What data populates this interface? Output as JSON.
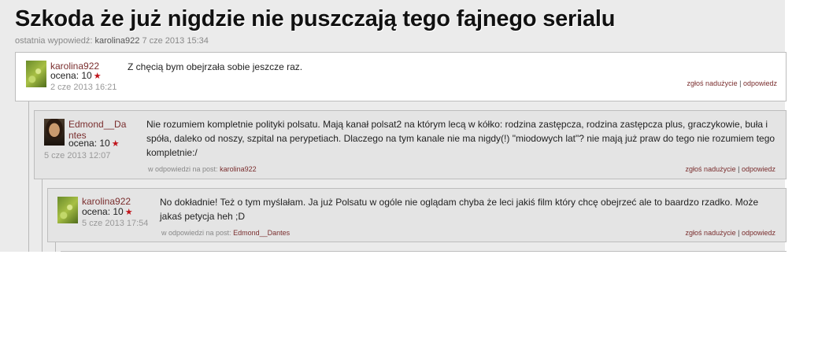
{
  "thread": {
    "title": "Szkoda że już nigdzie nie puszczają tego fajnego serialu",
    "meta_prefix": "ostatnia wypowiedź:",
    "meta_user": "karolina922",
    "meta_date": "7 cze 2013 15:34"
  },
  "posts": [
    {
      "author": "karolina922",
      "rating_label": "ocena: 10",
      "date": "2 cze 2013 16:21",
      "text": "Z chęcią bym obejrzała sobie jeszcze raz.",
      "report": "zgłoś nadużycie",
      "separator": "|",
      "reply": "odpowiedz"
    },
    {
      "author_line1": "Edmond__Da",
      "author_line2": "ntes",
      "rating_label": "ocena: 10",
      "date": "5 cze 2013 12:07",
      "text": "Nie rozumiem kompletnie polityki polsatu. Mają kanał polsat2 na którym lecą w kółko: rodzina zastępcza, rodzina zastępcza plus, graczykowie, buła i spóła, daleko od noszy, szpital na perypetiach. Dlaczego na tym kanale nie ma nigdy(!) \"miodowych lat\"? nie mają już praw do tego nie rozumiem tego kompletnie:/",
      "reply_prefix": "w odpowiedzi na post:",
      "reply_to": "karolina922",
      "report": "zgłoś nadużycie",
      "separator": "|",
      "reply": "odpowiedz"
    },
    {
      "author": "karolina922",
      "rating_label": "ocena: 10",
      "date": "5 cze 2013 17:54",
      "text": "No dokładnie! Też o tym myślałam. Ja już Polsatu w ogóle nie oglądam chyba że leci jakiś film który chcę obejrzeć ale to baardzo rzadko. Może jakaś petycja heh ;D",
      "reply_prefix": "w odpowiedzi na post:",
      "reply_to": "Edmond__Dantes",
      "report": "zgłoś nadużycie",
      "separator": "|",
      "reply": "odpowiedz"
    }
  ],
  "icons": {
    "star": "★"
  },
  "colors": {
    "author": "#7a2e2e",
    "star": "#c0141b"
  }
}
